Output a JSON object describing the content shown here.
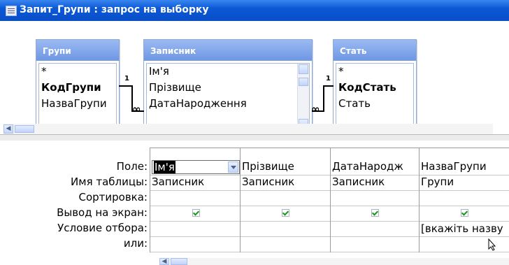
{
  "window": {
    "title": "Запит_Групи : запрос на выборку",
    "title_icon": "query-window-icon",
    "title_bar_color": "#0b58d6"
  },
  "tables": [
    {
      "name": "Групи",
      "fields": [
        "*",
        "КодГрупи",
        "НазваГрупи"
      ],
      "key_field": "КодГрупи"
    },
    {
      "name": "Записник",
      "fields": [
        "Ім'я",
        "Прізвище",
        "ДатаНародження"
      ],
      "scrollable": true
    },
    {
      "name": "Стать",
      "fields": [
        "*",
        "КодСтать",
        "Стать"
      ],
      "key_field": "КодСтать"
    }
  ],
  "relations": [
    {
      "from": "Групи",
      "to": "Записник",
      "from_label": "1",
      "to_label": "∞"
    },
    {
      "from": "Стать",
      "to": "Записник",
      "from_label": "1",
      "to_label": "∞"
    }
  ],
  "grid": {
    "row_labels": [
      "Поле:",
      "Имя таблицы:",
      "Сортировка:",
      "Вывод на экран:",
      "Условие отбора:",
      "или:"
    ],
    "columns": [
      {
        "field": "Ім'я",
        "table": "Записник",
        "sort": "",
        "show": true,
        "criteria": "",
        "or": "",
        "selected": true
      },
      {
        "field": "Прізвище",
        "table": "Записник",
        "sort": "",
        "show": true,
        "criteria": "",
        "or": ""
      },
      {
        "field": "ДатаНародж",
        "table": "Записник",
        "sort": "",
        "show": true,
        "criteria": "",
        "or": ""
      },
      {
        "field": "НазваГрупи",
        "table": "Групи",
        "sort": "",
        "show": true,
        "criteria": "[вкажіть назву",
        "or": ""
      }
    ]
  },
  "icons": {
    "scroll_left": "◀",
    "dropdown": "chevron-down-icon",
    "checkbox": "checkmark-icon",
    "cursor": "mouse-pointer-icon"
  },
  "colors": {
    "table_header": "#6f97e3",
    "checkmark": "#1a9a1a",
    "selection": "#000000"
  }
}
